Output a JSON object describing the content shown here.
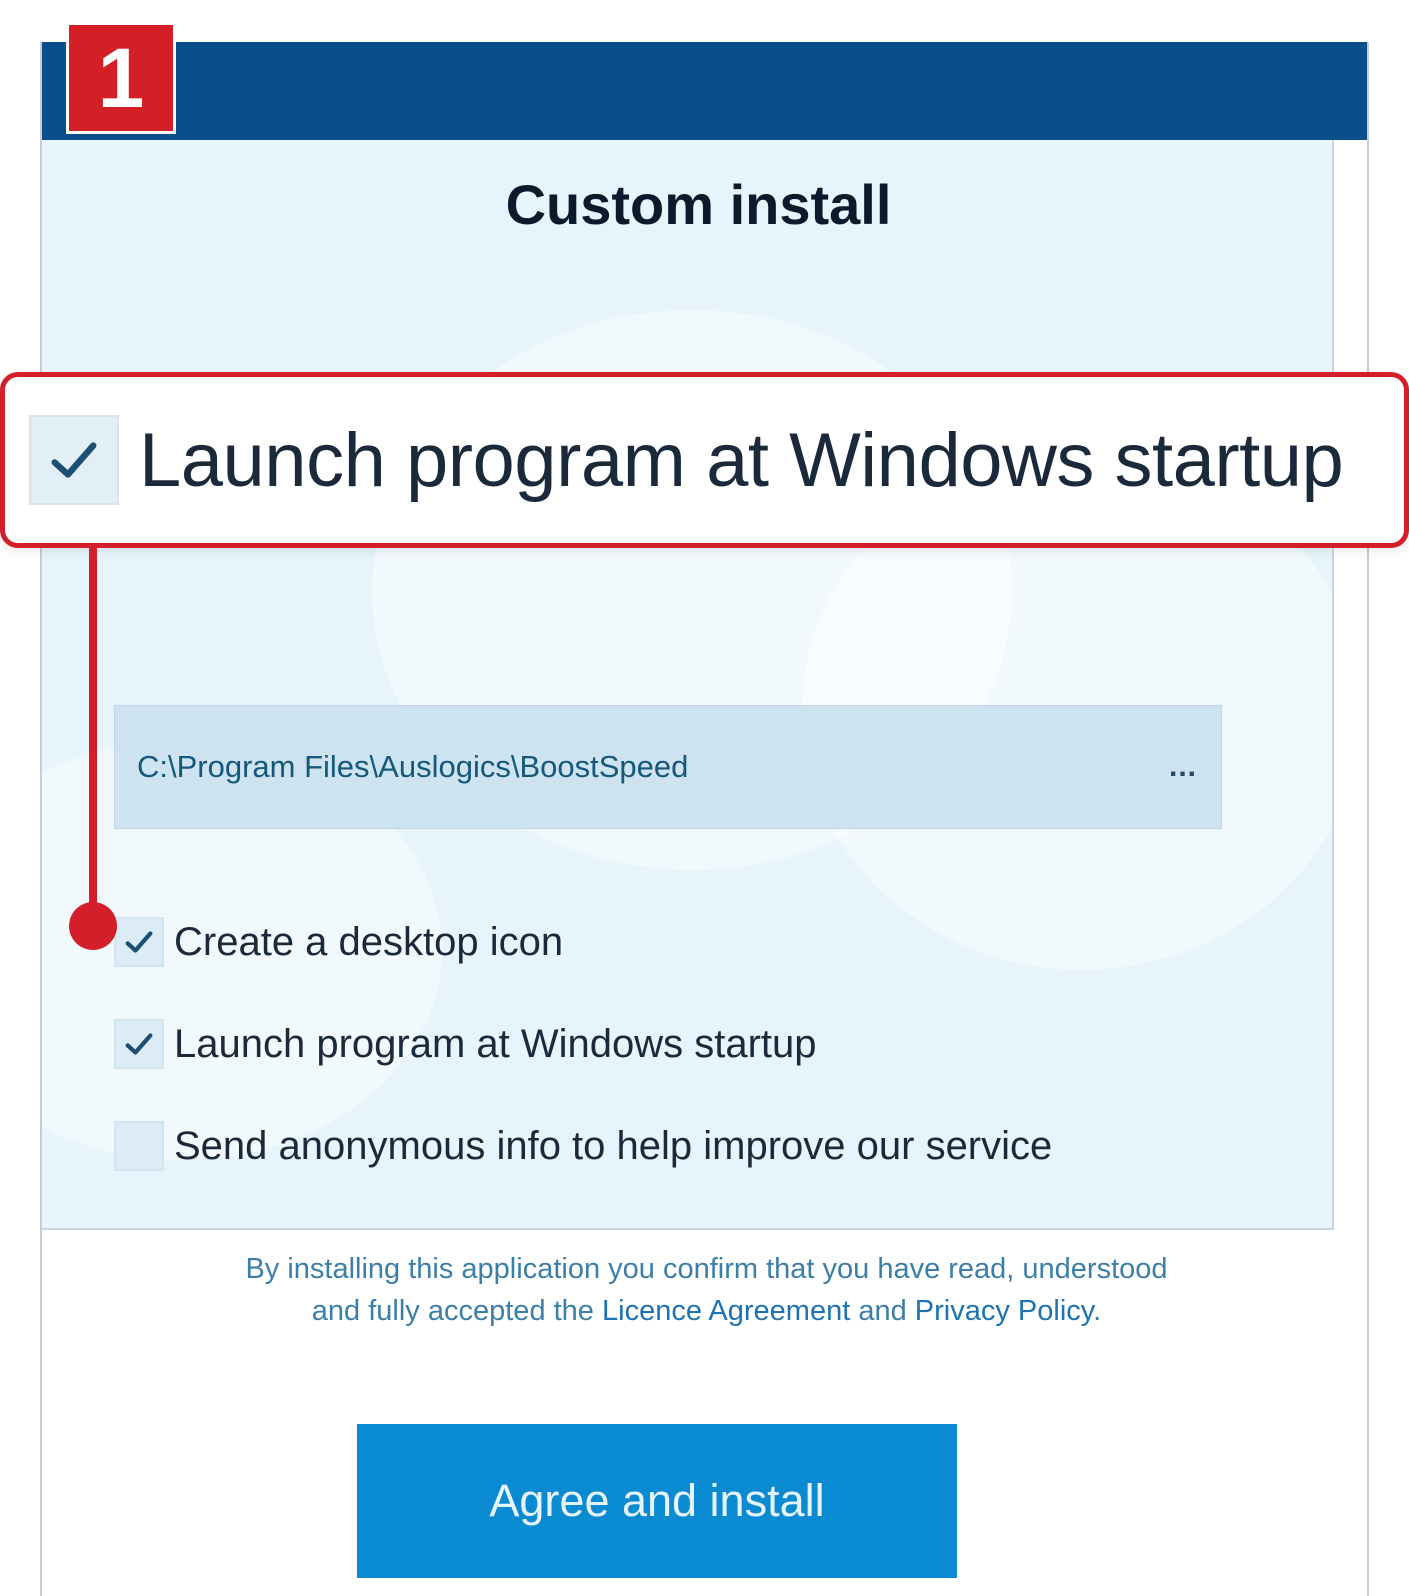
{
  "step_badge": "1",
  "dialog": {
    "title": "Custom install",
    "install_path": "C:\\Program Files\\Auslogics\\BoostSpeed",
    "browse_label": "...",
    "options": [
      {
        "label": "Create a desktop icon",
        "checked": true
      },
      {
        "label": "Launch program at Windows startup",
        "checked": true
      },
      {
        "label": "Send anonymous info to help improve our service",
        "checked": false
      }
    ],
    "legal": {
      "line1": "By installing this application you confirm that you have read, understood",
      "line2_prefix": "and fully accepted the ",
      "licence_link": "Licence Agreement",
      "and_text": " and ",
      "privacy_link": "Privacy Policy",
      "end": "."
    },
    "install_button": "Agree and install"
  },
  "callout": {
    "label": "Launch program at Windows startup",
    "checked": true
  },
  "colors": {
    "titlebar": "#0b4f8a",
    "panel": "#e7f4fb",
    "button": "#0a8bd1",
    "annotation": "#d41f2b"
  },
  "icons": {
    "checkmark": "check-icon"
  }
}
